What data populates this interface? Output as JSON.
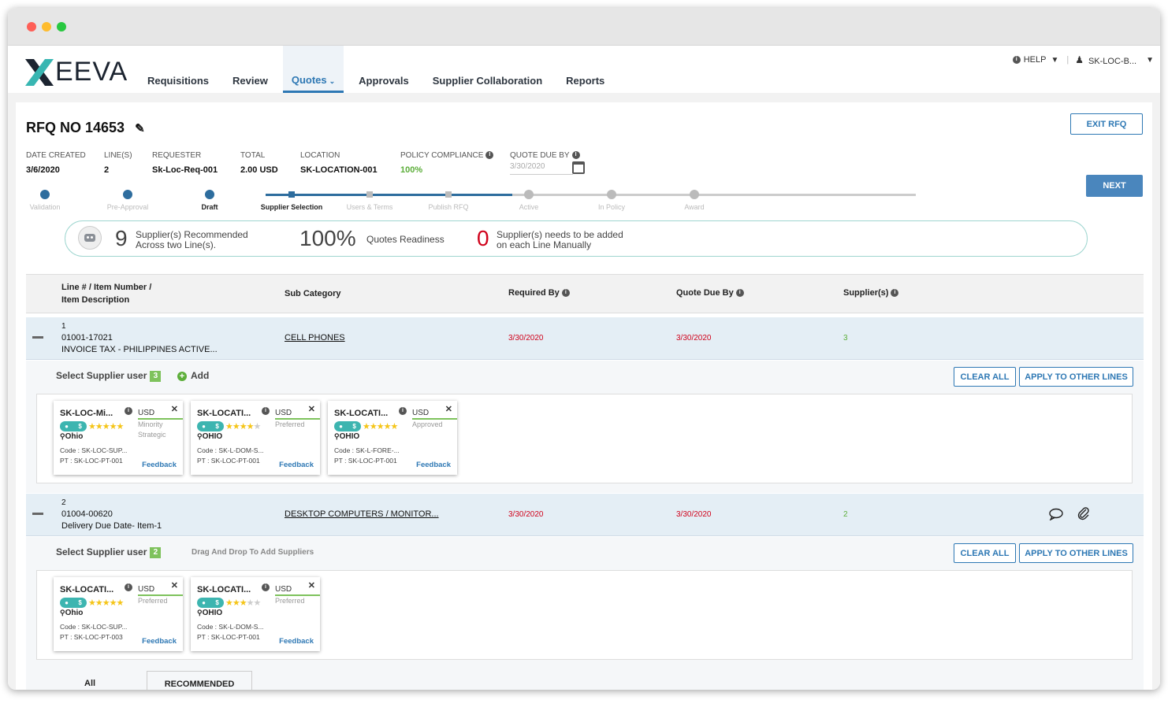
{
  "brand": {
    "logo_text": "EEVA"
  },
  "nav": {
    "items": [
      "Requisitions",
      "Review",
      "Quotes",
      "Approvals",
      "Supplier Collaboration",
      "Reports"
    ],
    "active": "Quotes"
  },
  "header": {
    "help": "HELP",
    "user": "SK-LOC-B..."
  },
  "rfq": {
    "title": "RFQ NO 14653",
    "labels": {
      "date_created": "DATE CREATED",
      "lines": "LINE(S)",
      "requester": "REQUESTER",
      "total": "TOTAL",
      "location": "LOCATION",
      "policy": "POLICY COMPLIANCE",
      "quote_due": "QUOTE DUE BY"
    },
    "values": {
      "date_created": "3/6/2020",
      "lines": "2",
      "requester": "Sk-Loc-Req-001",
      "total": "2.00 USD",
      "location": "SK-LOCATION-001",
      "policy": "100%",
      "quote_due": "3/30/2020"
    },
    "exit_button": "EXIT RFQ",
    "next_button": "NEXT"
  },
  "stepper": {
    "steps": [
      "Validation",
      "Pre-Approval",
      "Draft",
      "Supplier Selection",
      "Users & Terms",
      "Publish RFQ",
      "Active",
      "In Policy",
      "Award"
    ],
    "completed_count": 4,
    "current_index": 3
  },
  "summary": {
    "recommended_count": "9",
    "recommended_text1": "Supplier(s) Recommended",
    "recommended_text2": "Across two Line(s).",
    "readiness_pct": "100%",
    "readiness_text": "Quotes Readiness",
    "manual_count": "0",
    "manual_text1": "Supplier(s) needs to be added",
    "manual_text2": "on each Line Manually"
  },
  "grid": {
    "headers": {
      "line1": "Line # / Item Number /",
      "line2": "Item Description",
      "sub_category": "Sub Category",
      "required_by": "Required By",
      "quote_due_by": "Quote Due By",
      "suppliers": "Supplier(s)"
    }
  },
  "lines": [
    {
      "num": "1",
      "item": "01001-17021",
      "desc": "INVOICE TAX - PHILIPPINES ACTIVE...",
      "sub_category": "CELL PHONES",
      "required_by": "3/30/2020",
      "quote_due_by": "3/30/2020",
      "suppliers": "3",
      "select_label": "Select Supplier user",
      "select_count": "3",
      "add_label": "Add",
      "clear_all": "CLEAR ALL",
      "apply": "APPLY TO OTHER LINES",
      "cards": [
        {
          "name": "SK-LOC-Mi...",
          "currency": "USD",
          "tag1": "Minority",
          "tag2": "Strategic",
          "stars": 5,
          "location": "Ohio",
          "code": "Code : SK-LOC-SUP...",
          "pt": "PT : SK-LOC-PT-001",
          "feedback": "Feedback"
        },
        {
          "name": "SK-LOCATI...",
          "currency": "USD",
          "tag1": "Preferred",
          "tag2": "",
          "stars": 4,
          "location": "OHIO",
          "code": "Code : SK-L-DOM-S...",
          "pt": "PT : SK-LOC-PT-001",
          "feedback": "Feedback"
        },
        {
          "name": "SK-LOCATI...",
          "currency": "USD",
          "tag1": "Approved",
          "tag2": "",
          "stars": 5,
          "location": "OHIO",
          "code": "Code : SK-L-FORE-...",
          "pt": "PT : SK-LOC-PT-001",
          "feedback": "Feedback"
        }
      ]
    },
    {
      "num": "2",
      "item": "01004-00620",
      "desc": "Delivery Due Date- Item-1",
      "sub_category": "DESKTOP COMPUTERS / MONITOR...",
      "required_by": "3/30/2020",
      "quote_due_by": "3/30/2020",
      "suppliers": "2",
      "select_label": "Select Supplier user",
      "select_count": "2",
      "drag_label": "Drag And Drop To Add Suppliers",
      "clear_all": "CLEAR ALL",
      "apply": "APPLY TO OTHER LINES",
      "cards": [
        {
          "name": "SK-LOCATI...",
          "currency": "USD",
          "tag1": "Preferred",
          "tag2": "",
          "stars": 5,
          "location": "Ohio",
          "code": "Code : SK-LOC-SUP...",
          "pt": "PT : SK-LOC-PT-003",
          "feedback": "Feedback"
        },
        {
          "name": "SK-LOCATI...",
          "currency": "USD",
          "tag1": "Preferred",
          "tag2": "",
          "stars": 3,
          "location": "OHIO",
          "code": "Code : SK-L-DOM-S...",
          "pt": "PT : SK-LOC-PT-001",
          "feedback": "Feedback"
        }
      ]
    }
  ],
  "bottom_tabs": {
    "all": "All",
    "recommended": "RECOMMENDED"
  },
  "colors": {
    "accent": "#2e78b4",
    "teal": "#3db5b0",
    "green": "#7ec25c",
    "red": "#d0021b",
    "star": "#f5c518"
  }
}
